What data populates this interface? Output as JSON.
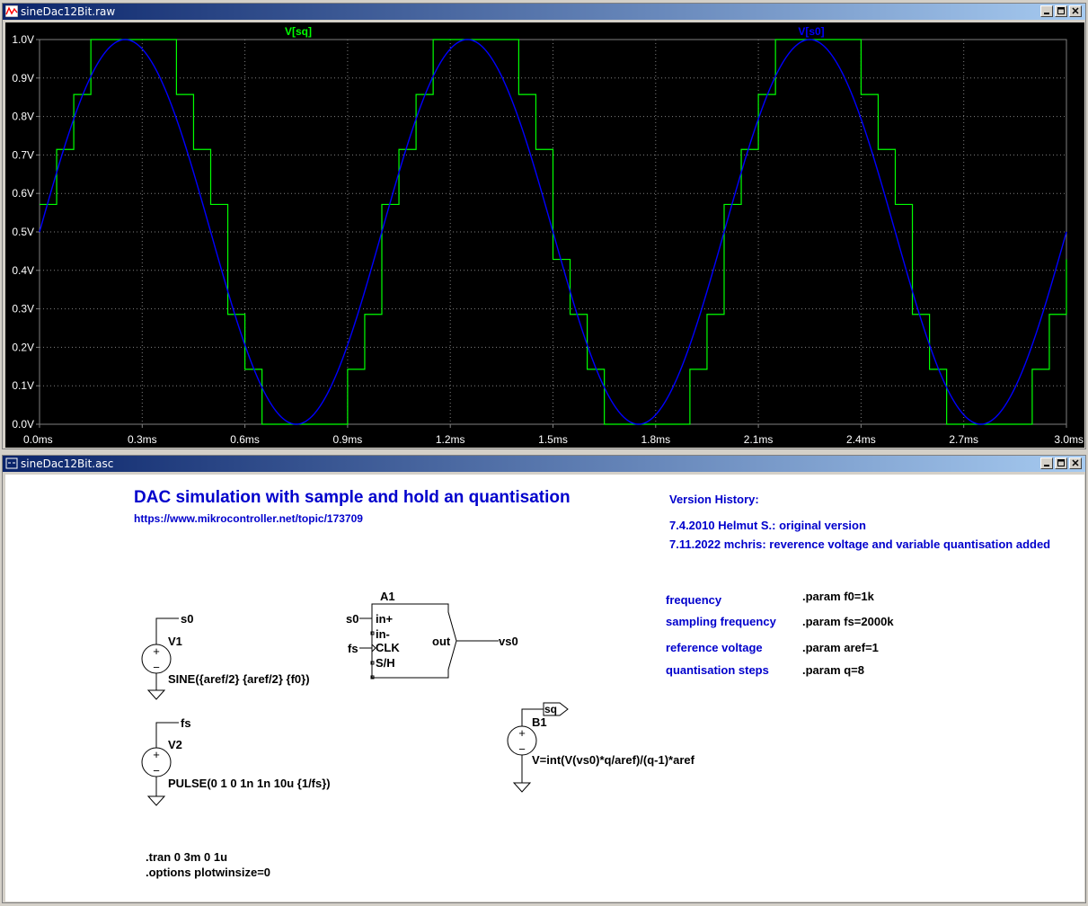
{
  "plot_window": {
    "title": "sineDac12Bit.raw",
    "trace_labels": [
      {
        "name": "V[sq]",
        "color": "#00ff00"
      },
      {
        "name": "V[s0]",
        "color": "#0000ff"
      }
    ]
  },
  "schematic_window": {
    "title": "sineDac12Bit.asc",
    "heading": "DAC simulation with sample and hold an quantisation",
    "url": "https://www.mikrocontroller.net/topic/173709",
    "version_title": "Version History:",
    "version_lines": [
      "7.4.2010 Helmut S.: original version",
      "7.11.2022 mchris: reverence voltage and variable quantisation added"
    ],
    "params": [
      {
        "label": "frequency",
        "value": ".param f0=1k"
      },
      {
        "label": "sampling frequency",
        "value": ".param fs=2000k"
      },
      {
        "label": "reference voltage",
        "value": ".param aref=1"
      },
      {
        "label": "quantisation steps",
        "value": ".param q=8"
      }
    ],
    "components": {
      "v1": {
        "name": "V1",
        "net": "s0",
        "value": "SINE({aref/2} {aref/2} {f0})"
      },
      "v2": {
        "name": "V2",
        "net": "fs",
        "value": "PULSE(0 1 0 1n 1n 10u {1/fs})"
      },
      "a1": {
        "name": "A1",
        "pins": [
          "in+",
          "in-",
          "CLK",
          "S/H"
        ],
        "out_pin": "out",
        "in_net_1": "s0",
        "in_net_2": "fs",
        "out_net": "vs0"
      },
      "b1": {
        "name": "B1",
        "net": "sq",
        "value": "V=int(V(vs0)*q/aref)/(q-1)*aref"
      }
    },
    "directives": [
      ".tran 0 3m 0 1u",
      ".options plotwinsize=0"
    ]
  },
  "chart_data": {
    "type": "line",
    "title": "",
    "xlabel": "",
    "ylabel": "",
    "xlim": [
      0,
      3.0
    ],
    "ylim": [
      0,
      1.0
    ],
    "x_unit": "ms",
    "y_unit": "V",
    "x_ticks": [
      "0.0ms",
      "0.3ms",
      "0.6ms",
      "0.9ms",
      "1.2ms",
      "1.5ms",
      "1.8ms",
      "2.1ms",
      "2.4ms",
      "2.7ms",
      "3.0ms"
    ],
    "y_ticks": [
      "0.0V",
      "0.1V",
      "0.2V",
      "0.3V",
      "0.4V",
      "0.5V",
      "0.6V",
      "0.7V",
      "0.8V",
      "0.9V",
      "1.0V"
    ],
    "grid": true,
    "series": [
      {
        "name": "V[s0]",
        "color": "#0000ff",
        "kind": "sine",
        "offset": 0.5,
        "amplitude": 0.5,
        "frequency_khz": 1
      },
      {
        "name": "V[sq]",
        "color": "#00ff00",
        "kind": "step",
        "levels": [
          0,
          0.1429,
          0.2857,
          0.4286,
          0.5714,
          0.7143,
          0.8571,
          1.0
        ],
        "sample_interval_ms": 0.05
      }
    ]
  }
}
